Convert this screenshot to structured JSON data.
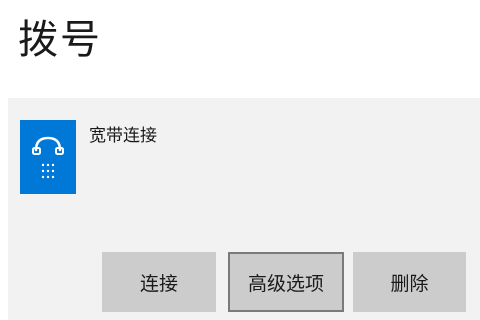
{
  "page": {
    "title": "拨号"
  },
  "connection": {
    "icon": "dial-up-phone-icon",
    "name": "宽带连接"
  },
  "actions": {
    "connect_label": "连接",
    "advanced_label": "高级选项",
    "delete_label": "删除"
  },
  "colors": {
    "icon_background": "#0078d7",
    "panel_background": "#f2f2f2",
    "button_background": "#cccccc"
  }
}
